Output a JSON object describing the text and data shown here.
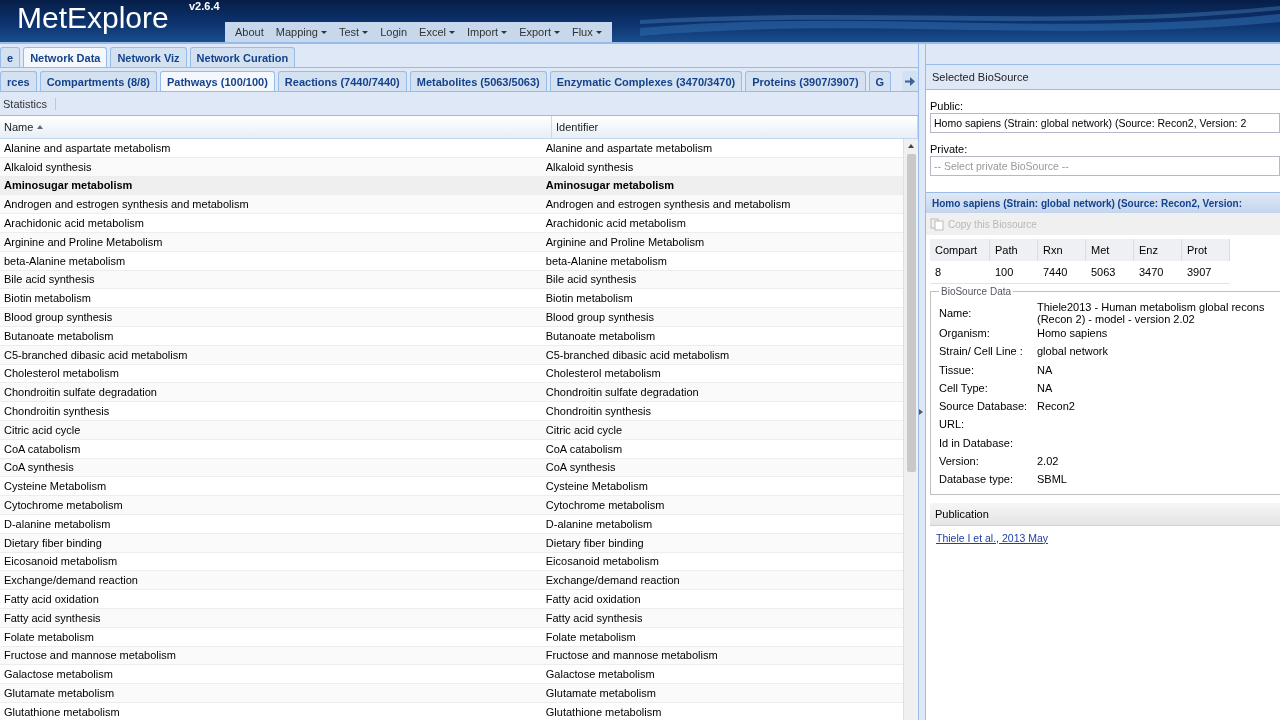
{
  "app": {
    "title": "MetExplore",
    "version": "v2.6.4"
  },
  "menu": [
    {
      "label": "About",
      "dropdown": false
    },
    {
      "label": "Mapping",
      "dropdown": true
    },
    {
      "label": "Test",
      "dropdown": true
    },
    {
      "label": "Login",
      "dropdown": false
    },
    {
      "label": "Excel",
      "dropdown": true
    },
    {
      "label": "Import",
      "dropdown": true
    },
    {
      "label": "Export",
      "dropdown": true
    },
    {
      "label": "Flux",
      "dropdown": true
    }
  ],
  "main_tabs": [
    {
      "label": "e",
      "selected": false
    },
    {
      "label": "Network Data",
      "selected": true
    },
    {
      "label": "Network Viz",
      "selected": false
    },
    {
      "label": "Network Curation",
      "selected": false
    }
  ],
  "data_tabs": [
    {
      "label": "rces",
      "selected": false
    },
    {
      "label": "Compartments (8/8)",
      "selected": false
    },
    {
      "label": "Pathways (100/100)",
      "selected": true
    },
    {
      "label": "Reactions (7440/7440)",
      "selected": false
    },
    {
      "label": "Metabolites (5063/5063)",
      "selected": false
    },
    {
      "label": "Enzymatic Complexes (3470/3470)",
      "selected": false
    },
    {
      "label": "Proteins (3907/3907)",
      "selected": false
    },
    {
      "label": "G",
      "selected": false
    }
  ],
  "toolbar": {
    "button": "Statistics"
  },
  "table": {
    "columns": [
      {
        "label": "Name",
        "sorted": true
      },
      {
        "label": "Identifier",
        "sorted": false
      }
    ],
    "rows": [
      {
        "name": "Alanine and aspartate metabolism",
        "identifier": "Alanine and aspartate metabolism",
        "selected": false
      },
      {
        "name": "Alkaloid synthesis",
        "identifier": "Alkaloid synthesis",
        "selected": false
      },
      {
        "name": "Aminosugar metabolism",
        "identifier": "Aminosugar metabolism",
        "selected": true
      },
      {
        "name": "Androgen and estrogen synthesis and metabolism",
        "identifier": "Androgen and estrogen synthesis and metabolism",
        "selected": false
      },
      {
        "name": "Arachidonic acid metabolism",
        "identifier": "Arachidonic acid metabolism",
        "selected": false
      },
      {
        "name": "Arginine and Proline Metabolism",
        "identifier": "Arginine and Proline Metabolism",
        "selected": false
      },
      {
        "name": "beta-Alanine metabolism",
        "identifier": "beta-Alanine metabolism",
        "selected": false
      },
      {
        "name": "Bile acid synthesis",
        "identifier": "Bile acid synthesis",
        "selected": false
      },
      {
        "name": "Biotin metabolism",
        "identifier": "Biotin metabolism",
        "selected": false
      },
      {
        "name": "Blood group synthesis",
        "identifier": "Blood group synthesis",
        "selected": false
      },
      {
        "name": "Butanoate metabolism",
        "identifier": "Butanoate metabolism",
        "selected": false
      },
      {
        "name": "C5-branched dibasic acid metabolism",
        "identifier": "C5-branched dibasic acid metabolism",
        "selected": false
      },
      {
        "name": "Cholesterol metabolism",
        "identifier": "Cholesterol metabolism",
        "selected": false
      },
      {
        "name": "Chondroitin sulfate degradation",
        "identifier": "Chondroitin sulfate degradation",
        "selected": false
      },
      {
        "name": "Chondroitin synthesis",
        "identifier": "Chondroitin synthesis",
        "selected": false
      },
      {
        "name": "Citric acid cycle",
        "identifier": "Citric acid cycle",
        "selected": false
      },
      {
        "name": "CoA catabolism",
        "identifier": "CoA catabolism",
        "selected": false
      },
      {
        "name": "CoA synthesis",
        "identifier": "CoA synthesis",
        "selected": false
      },
      {
        "name": "Cysteine Metabolism",
        "identifier": "Cysteine Metabolism",
        "selected": false
      },
      {
        "name": "Cytochrome metabolism",
        "identifier": "Cytochrome metabolism",
        "selected": false
      },
      {
        "name": "D-alanine metabolism",
        "identifier": "D-alanine metabolism",
        "selected": false
      },
      {
        "name": "Dietary fiber binding",
        "identifier": "Dietary fiber binding",
        "selected": false
      },
      {
        "name": "Eicosanoid metabolism",
        "identifier": "Eicosanoid metabolism",
        "selected": false
      },
      {
        "name": "Exchange/demand reaction",
        "identifier": "Exchange/demand reaction",
        "selected": false
      },
      {
        "name": "Fatty acid oxidation",
        "identifier": "Fatty acid oxidation",
        "selected": false
      },
      {
        "name": "Fatty acid synthesis",
        "identifier": "Fatty acid synthesis",
        "selected": false
      },
      {
        "name": "Folate metabolism",
        "identifier": "Folate metabolism",
        "selected": false
      },
      {
        "name": "Fructose and mannose metabolism",
        "identifier": "Fructose and mannose metabolism",
        "selected": false
      },
      {
        "name": "Galactose metabolism",
        "identifier": "Galactose metabolism",
        "selected": false
      },
      {
        "name": "Glutamate metabolism",
        "identifier": "Glutamate metabolism",
        "selected": false
      },
      {
        "name": "Glutathione metabolism",
        "identifier": "Glutathione metabolism",
        "selected": false
      }
    ]
  },
  "side_panel": {
    "title": "Selected BioSource",
    "public": {
      "label": "Public:",
      "value": "Homo sapiens (Strain: global network) (Source: Recon2, Version: 2"
    },
    "private": {
      "label": "Private:",
      "placeholder": "-- Select private BioSource --"
    },
    "biosource_title": "Homo sapiens (Strain: global network) (Source: Recon2, Version:",
    "copy_button": {
      "label": "Copy this Biosource",
      "disabled": true
    },
    "stats": {
      "columns": [
        "Compart",
        "Path",
        "Rxn",
        "Met",
        "Enz",
        "Prot"
      ],
      "values": [
        "8",
        "100",
        "7440",
        "5063",
        "3470",
        "3907"
      ]
    },
    "biosource_data": {
      "legend": "BioSource Data",
      "fields": [
        {
          "label": "Name:",
          "value": "Thiele2013 - Human metabolism global recons\n(Recon 2) - model - version 2.02"
        },
        {
          "label": "Organism:",
          "value": "Homo sapiens"
        },
        {
          "label": "Strain/ Cell Line :",
          "value": "global network"
        },
        {
          "label": "Tissue:",
          "value": "NA"
        },
        {
          "label": "Cell Type:",
          "value": "NA"
        },
        {
          "label": "Source Database:",
          "value": "Recon2"
        },
        {
          "label": "URL:"
        },
        {
          "label": "Id in Database:"
        },
        {
          "label": "Version:",
          "value": "2.02"
        },
        {
          "label": "Database type:",
          "value": "SBML"
        }
      ]
    },
    "publication": {
      "title": "Publication",
      "link": "Thiele I et al., 2013 May"
    }
  }
}
